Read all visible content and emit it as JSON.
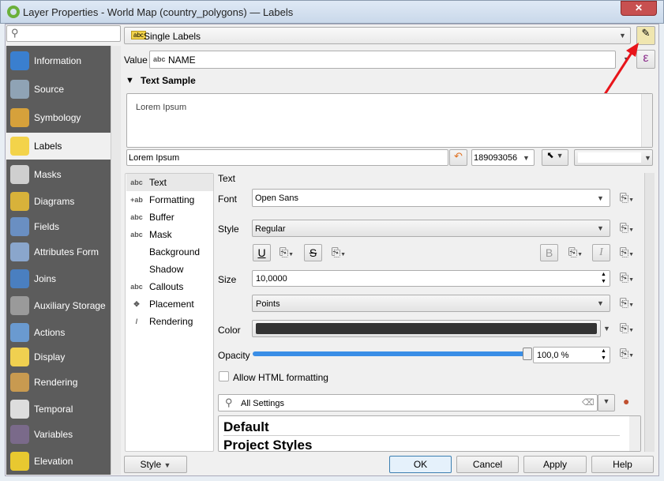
{
  "window": {
    "title": "Layer Properties - World Map (country_polygons) — Labels",
    "close": "✕"
  },
  "search": {
    "placeholder": ""
  },
  "sidebar": {
    "items": [
      {
        "label": "Information",
        "icon": "info-icon",
        "color": "#3a7fcf"
      },
      {
        "label": "Source",
        "icon": "source-icon",
        "color": "#8fa3b5"
      },
      {
        "label": "Symbology",
        "icon": "symbology-icon",
        "color": "#d6a13b"
      },
      {
        "label": "Labels",
        "icon": "labels-icon",
        "color": "#f3d34a"
      },
      {
        "label": "Masks",
        "icon": "masks-icon",
        "color": "#cfcfcf"
      },
      {
        "label": "Diagrams",
        "icon": "diagrams-icon",
        "color": "#d8b23a"
      },
      {
        "label": "Fields",
        "icon": "fields-icon",
        "color": "#6a8fc2"
      },
      {
        "label": "Attributes Form",
        "icon": "attributes-form-icon",
        "color": "#8aa6cc"
      },
      {
        "label": "Joins",
        "icon": "joins-icon",
        "color": "#4a7fc0"
      },
      {
        "label": "Auxiliary Storage",
        "icon": "auxiliary-storage-icon",
        "color": "#9a9a9a"
      },
      {
        "label": "Actions",
        "icon": "actions-icon",
        "color": "#6a9ad0"
      },
      {
        "label": "Display",
        "icon": "display-icon",
        "color": "#f0d050"
      },
      {
        "label": "Rendering",
        "icon": "rendering-icon",
        "color": "#c89a50"
      },
      {
        "label": "Temporal",
        "icon": "temporal-icon",
        "color": "#dddddd"
      },
      {
        "label": "Variables",
        "icon": "variables-icon",
        "color": "#7a6a8a"
      },
      {
        "label": "Elevation",
        "icon": "elevation-icon",
        "color": "#e8c830"
      }
    ],
    "selected": "Labels"
  },
  "mode": {
    "value": "Single Labels",
    "badge": "abc"
  },
  "value": {
    "label": "Value",
    "badge": "abc",
    "field": "NAME",
    "expr": "ε"
  },
  "sample": {
    "header": "Text Sample",
    "preview": "Lorem Ipsum",
    "input": "Lorem Ipsum",
    "scale": "189093056"
  },
  "tabs": {
    "items": [
      "Text",
      "Formatting",
      "Buffer",
      "Mask",
      "Background",
      "Shadow",
      "Callouts",
      "Placement",
      "Rendering"
    ],
    "icons": [
      "abc",
      "+ab",
      "abc",
      "abc",
      "",
      "",
      "abc",
      "✥",
      "/"
    ],
    "selected": "Text"
  },
  "text": {
    "section": "Text",
    "font_label": "Font",
    "font": "Open Sans",
    "style_label": "Style",
    "style": "Regular",
    "underline": "U",
    "strike": "S",
    "bold": "B",
    "italic": "I",
    "size_label": "Size",
    "size": "10,0000",
    "unit": "Points",
    "color_label": "Color",
    "color": "#333333",
    "opacity_label": "Opacity",
    "opacity": "100,0 %",
    "opacity_percent": 100,
    "html_label": "Allow HTML formatting",
    "html_checked": false
  },
  "styles": {
    "search": "All Settings",
    "items": [
      "Default",
      "Project Styles"
    ]
  },
  "footer": {
    "style": "Style",
    "ok": "OK",
    "cancel": "Cancel",
    "apply": "Apply",
    "help": "Help"
  }
}
